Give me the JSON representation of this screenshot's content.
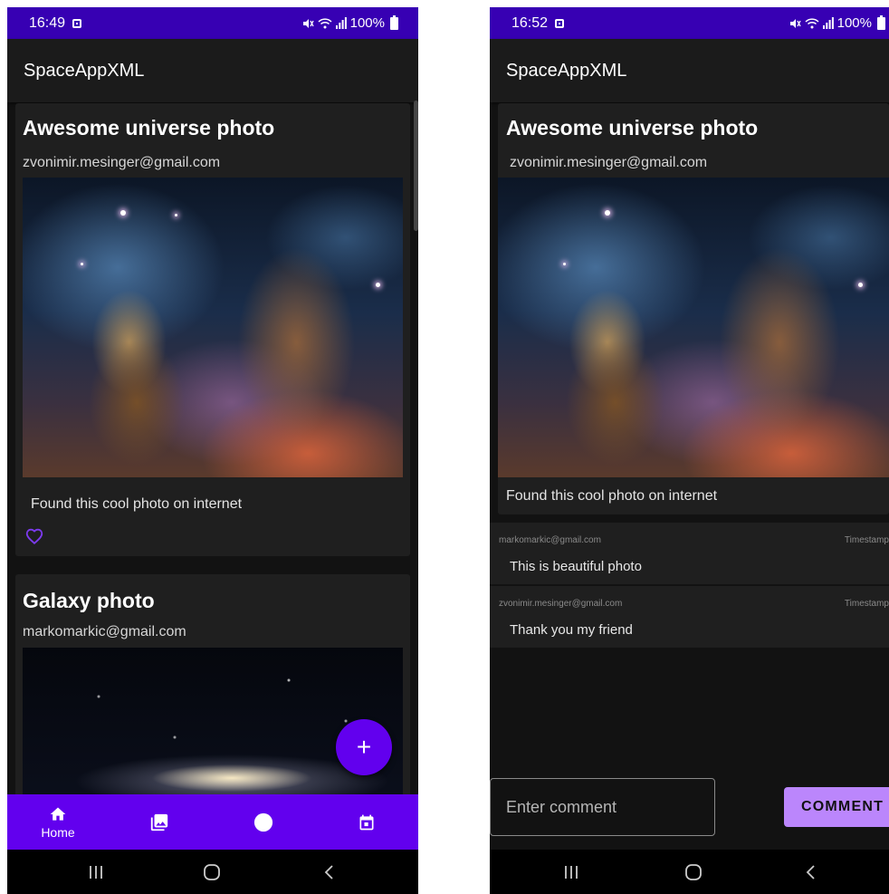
{
  "app_title": "SpaceAppXML",
  "colors": {
    "status_bar": "#3700b3",
    "primary": "#6200ee",
    "accent": "#bb86fc",
    "background": "#121212",
    "card": "#1f1f1f"
  },
  "icons": {
    "like": "heart-outline-icon",
    "add": "plus-icon",
    "home": "home-icon",
    "gallery": "image-icon",
    "profile": "circle-icon",
    "calendar": "calendar-icon",
    "recents": "recents-icon",
    "home_sys": "home-circle-icon",
    "back": "back-chevron-icon"
  },
  "left_screen": {
    "status": {
      "time": "16:49",
      "battery": "100%"
    },
    "posts": [
      {
        "title": "Awesome universe photo",
        "email": "zvonimir.mesinger@gmail.com",
        "description": "Found this cool photo on internet"
      },
      {
        "title": "Galaxy photo",
        "email": "markomarkic@gmail.com"
      }
    ],
    "fab_label": "+",
    "bottom_nav": {
      "items": [
        {
          "label": "Home",
          "icon": "home-icon",
          "selected": true
        },
        {
          "label": "",
          "icon": "image-icon",
          "selected": false
        },
        {
          "label": "",
          "icon": "circle-icon",
          "selected": false
        },
        {
          "label": "",
          "icon": "calendar-icon",
          "selected": false
        }
      ]
    }
  },
  "right_screen": {
    "status": {
      "time": "16:52",
      "battery": "100%"
    },
    "post": {
      "title": "Awesome universe photo",
      "email": "zvonimir.mesinger@gmail.com",
      "description": "Found this cool photo on internet"
    },
    "comments": [
      {
        "author": "markomarkic@gmail.com",
        "timestamp": "Timestamp",
        "text": "This is beautiful photo"
      },
      {
        "author": "zvonimir.mesinger@gmail.com",
        "timestamp": "Timestamp",
        "text": "Thank you my friend"
      }
    ],
    "comment_input": {
      "placeholder": "Enter comment",
      "value": ""
    },
    "comment_button": "COMMENT"
  }
}
